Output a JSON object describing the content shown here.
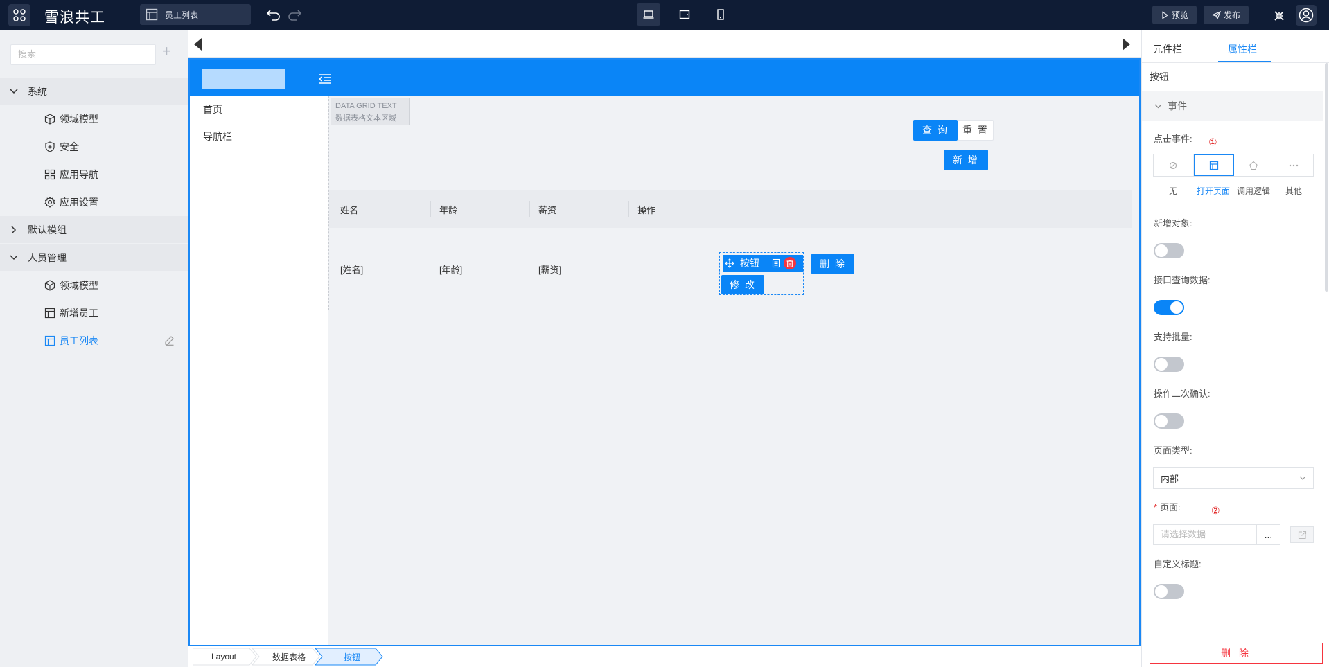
{
  "app": {
    "title": "雪浪共工",
    "current_page": "员工列表"
  },
  "toolbar": {
    "preview_label": "预览",
    "publish_label": "发布"
  },
  "sidebar": {
    "search_placeholder": "搜索",
    "add_icon": "plus-icon",
    "groups": [
      {
        "label": "系统",
        "expanded": true,
        "items": [
          {
            "label": "领域模型",
            "icon": "cube-icon"
          },
          {
            "label": "安全",
            "icon": "shield-plus-icon"
          },
          {
            "label": "应用导航",
            "icon": "grid-icon"
          },
          {
            "label": "应用设置",
            "icon": "gear-icon"
          }
        ]
      },
      {
        "label": "默认模组",
        "expanded": false,
        "items": []
      },
      {
        "label": "人员管理",
        "expanded": true,
        "items": [
          {
            "label": "领域模型",
            "icon": "cube-icon"
          },
          {
            "label": "新增员工",
            "icon": "layout-icon"
          },
          {
            "label": "员工列表",
            "icon": "layout-icon",
            "active": true
          }
        ]
      }
    ]
  },
  "canvas": {
    "nav": {
      "items": [
        "首页",
        "导航栏"
      ]
    },
    "grid": {
      "tag_line1": "DATA GRID TEXT",
      "tag_line2": "数据表格文本区域",
      "query_label": "查 询",
      "reset_label": "重 置",
      "add_label": "新 增",
      "columns": [
        "姓名",
        "年龄",
        "薪资",
        "操作"
      ],
      "row": [
        "[姓名]",
        "[年龄]",
        "[薪资]"
      ],
      "selected_button_label": "按钮",
      "delete_label": "删 除",
      "modify_label": "修 改"
    }
  },
  "breadcrumb": [
    "Layout",
    "数据表格",
    "按钮"
  ],
  "panel": {
    "tabs": [
      "元件栏",
      "属性栏"
    ],
    "active_tab": "属性栏",
    "component_name": "按钮",
    "section_title": "事件",
    "click_event_label": "点击事件:",
    "marker_1": "①",
    "marker_2": "②",
    "event_options": [
      "无",
      "打开页面",
      "调用逻辑",
      "其他"
    ],
    "active_event": "打开页面",
    "new_object_label": "新增对象:",
    "new_object_on": false,
    "api_query_label": "接口查询数据:",
    "api_query_on": true,
    "batch_label": "支持批量:",
    "batch_on": false,
    "confirm_label": "操作二次确认:",
    "confirm_on": false,
    "page_type_label": "页面类型:",
    "page_type_value": "内部",
    "page_label": "页面:",
    "page_placeholder": "请选择数据",
    "dots_label": "...",
    "custom_title_label": "自定义标题:",
    "custom_title_on": false,
    "delete_label": "删 除"
  },
  "colors": {
    "topbar": "#0f1c35",
    "accent": "#0a85f7",
    "danger": "#f5353f"
  }
}
